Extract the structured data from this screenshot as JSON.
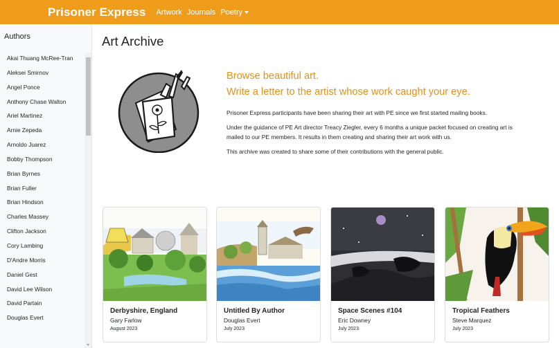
{
  "navbar": {
    "brand": "Prisoner Express",
    "links": [
      "Artwork",
      "Journals",
      "Poetry"
    ]
  },
  "sidebar": {
    "title": "Authors",
    "authors": [
      "Akai Thuang McRee-Tran",
      "Aleksei Smirnov",
      "Angel Ponce",
      "Anthony Chase Walton",
      "Ariel Martinez",
      "Arnie Zepeda",
      "Arnoldo Juarez",
      "Bobby Thompson",
      "Brian Byrnes",
      "Brian Fuller",
      "Brian Hindson",
      "Charles Massey",
      "Clifton Jackson",
      "Cory Lambing",
      "D'Andre Morris",
      "Daniel Gest",
      "David Lee Wilson",
      "David Partain",
      "Douglas Evert"
    ]
  },
  "main": {
    "title": "Art Archive",
    "headline_1": "Browse beautiful art.",
    "headline_2": "Write a letter to the artist whose work caught your eye.",
    "paragraphs": [
      "Prisoner Express participants have been sharing their art with PE since we first started mailing books.",
      "Under the guidance of PE Art director Treacy Ziegler, every 6 months a unique packet focused on creating art is mailed to our PE members. It results in them creating and sharing their art work with us.",
      "This archive was created to share some of their contributions with the general public."
    ]
  },
  "cards": [
    {
      "title": "Derbyshire, England",
      "author": "Gary Farlow",
      "date": "August 2023"
    },
    {
      "title": "Untitled By Author",
      "author": "Douglas Evert",
      "date": "July 2023"
    },
    {
      "title": "Space Scenes #104",
      "author": "Eric Downey",
      "date": "July 2023"
    },
    {
      "title": "Tropical Feathers",
      "author": "Steve Marquez",
      "date": "July 2023"
    }
  ],
  "colors": {
    "navbar": "#f09c1b",
    "headline": "#e5901a",
    "sidebar_bg": "#f8f9fa"
  },
  "icons": [
    "caret-down-icon",
    "art-archive-logo",
    "scroll-down-arrow-icon"
  ]
}
